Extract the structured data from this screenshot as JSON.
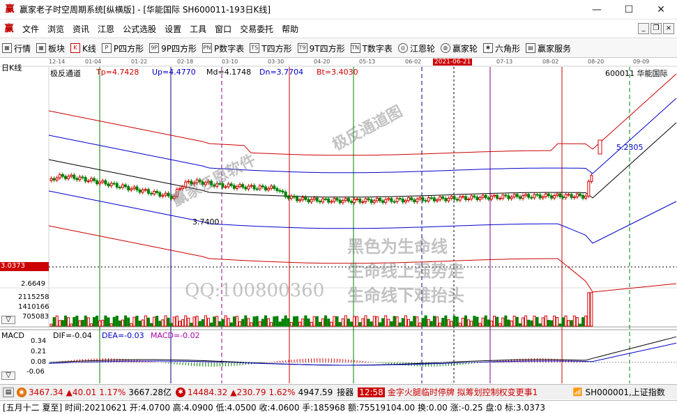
{
  "window": {
    "title": "赢家老子时空周期系统[纵横版] - [华能国际  SH600011-193日K线]",
    "minimize": "—",
    "maximize": "☐",
    "close": "✕"
  },
  "menu": {
    "logo": "赢",
    "items": [
      "文件",
      "浏览",
      "资讯",
      "江恩",
      "公式选股",
      "设置",
      "工具",
      "窗口",
      "交易委托",
      "帮助"
    ]
  },
  "toolbar": {
    "buttons": [
      {
        "label": "行情",
        "icon": "grid-icon"
      },
      {
        "label": "板块",
        "icon": "sector-icon"
      },
      {
        "label": "K线",
        "icon": "kline-icon"
      },
      {
        "label": "P四方形",
        "icon": "p-square-icon"
      },
      {
        "label": "9P四方形",
        "icon": "9p-square-icon"
      },
      {
        "label": "P数字表",
        "icon": "p-table-icon"
      },
      {
        "label": "T四方形",
        "icon": "t-square-icon"
      },
      {
        "label": "9T四方形",
        "icon": "9t-square-icon"
      },
      {
        "label": "T数字表",
        "icon": "t-table-icon"
      },
      {
        "label": "江恩轮",
        "icon": "gann-wheel-icon"
      },
      {
        "label": "赢家轮",
        "icon": "winner-wheel-icon"
      },
      {
        "label": "六角形",
        "icon": "hexagon-icon"
      },
      {
        "label": "赢家服务",
        "icon": "service-icon"
      }
    ],
    "icon_glyphs": [
      "▦",
      "▦",
      "K",
      "P",
      "9P",
      "PN",
      "TS",
      "T9",
      "TN",
      "◎",
      "◍",
      "✱",
      "▤"
    ]
  },
  "chart": {
    "period_label": "日K线",
    "indicator_name": "极反通道",
    "indicator_values": [
      {
        "label": "Tp=4.7428",
        "color": "#cc0000"
      },
      {
        "label": "Up=4.4770",
        "color": "#0000cc"
      },
      {
        "label": "Md=4.1748",
        "color": "#000000"
      },
      {
        "label": "Dn=3.7704",
        "color": "#0000cc"
      },
      {
        "label": "Bt=3.4030",
        "color": "#cc0000"
      }
    ],
    "stock_label": "600011  华能国际",
    "date_ticks": [
      "12-14",
      "01-04",
      "01-22",
      "02-18",
      "03-10",
      "03-30",
      "04-20",
      "05-13",
      "06-02",
      "2021-06-21",
      "07-13",
      "08-02",
      "08-20",
      "09-09"
    ],
    "highlight_date": "2021-06-21",
    "price_left_marker": "3.0373",
    "low_price_label": "3.7400",
    "high_price_label": "5.2305",
    "left_scale": [
      "2.6649",
      "2115258",
      "1410166",
      "705083"
    ],
    "macd": {
      "name": "MACD",
      "dif": "DIF=-0.04",
      "dea": "DEA=-0.03",
      "macd": "MACD=-0.02",
      "scale": [
        "0.34",
        "0.21",
        "0.08",
        "-0.06"
      ]
    },
    "colors": {
      "up": "#d40000",
      "down": "#008000",
      "channel_outer": "#cc0000",
      "channel_inner": "#0000cc",
      "channel_mid": "#000000",
      "highlight_bg": "#cc0000",
      "macd_dea": "#aa00aa"
    }
  },
  "watermarks": {
    "author": "赢家江恩软件",
    "chart_name": "极反通道图",
    "line1": "黑色为生命线",
    "line2": "生命线上强势走",
    "line3": "生命线下难抬头",
    "qq": "QQ:100800360"
  },
  "statusbar": {
    "index1": {
      "value": "3467.34",
      "change": "▲40.01",
      "pct": "1.17%",
      "amount": "3667.28亿"
    },
    "index2": {
      "value": "14484.32",
      "change": "▲230.79",
      "pct": "1.62%",
      "amount": "4947.59"
    },
    "news_source": "接器",
    "news_time": "12:58",
    "news_text": "金字火腿临时停牌 拟筹划控制权变更事1",
    "index_label": "SH000001,上证指数"
  },
  "infobar": {
    "text": "[五月十二 夏至] 时间:20210621 开:4.0700 高:4.0900 低:4.0500 收:4.0600 手:185968 额:75519104.00 换:0.00 涨:-0.25 盘:0 标:3.0373"
  }
}
